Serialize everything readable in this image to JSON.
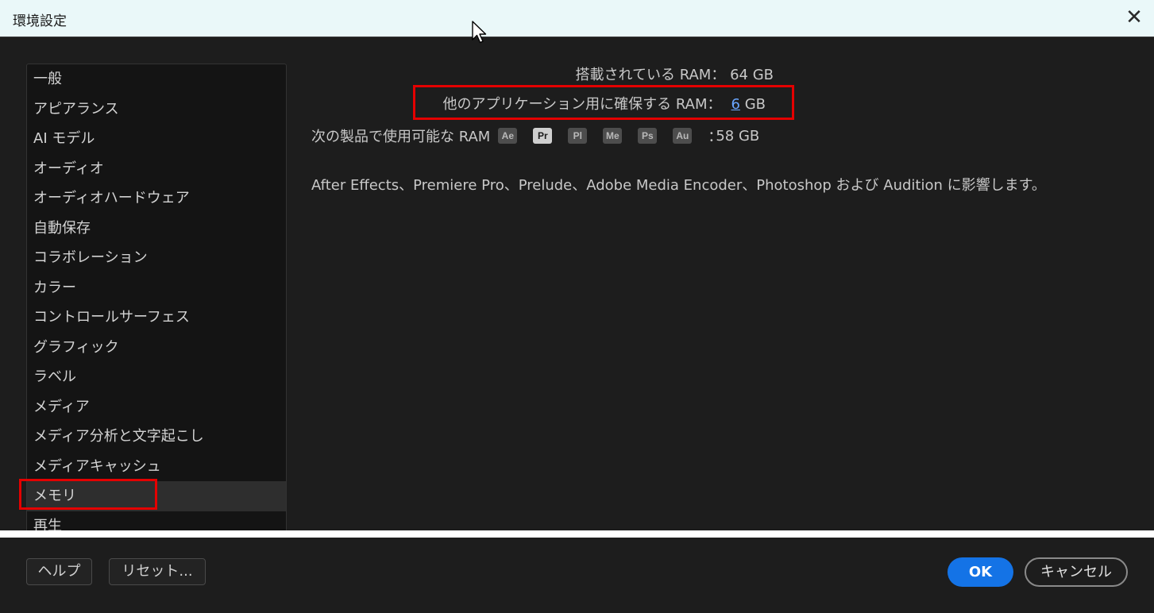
{
  "window": {
    "title": "環境設定",
    "close_glyph": "✕"
  },
  "sidebar": {
    "items": [
      {
        "label": "一般"
      },
      {
        "label": "アピアランス"
      },
      {
        "label": "AI モデル"
      },
      {
        "label": "オーディオ"
      },
      {
        "label": "オーディオハードウェア"
      },
      {
        "label": "自動保存"
      },
      {
        "label": "コラボレーション"
      },
      {
        "label": "カラー"
      },
      {
        "label": "コントロールサーフェス"
      },
      {
        "label": "グラフィック"
      },
      {
        "label": "ラベル"
      },
      {
        "label": "メディア"
      },
      {
        "label": "メディア分析と文字起こし"
      },
      {
        "label": "メディアキャッシュ"
      },
      {
        "label": "メモリ"
      },
      {
        "label": "再生"
      }
    ],
    "selected_label": "メモリ"
  },
  "memory": {
    "installed_label": "搭載されている RAM：",
    "installed_value": "64 GB",
    "reserved_label": "他のアプリケーション用に確保する RAM：",
    "reserved_value": "6",
    "reserved_unit": "GB",
    "available_label": "次の製品で使用可能な RAM",
    "products": [
      {
        "abbr": "Ae",
        "active": false
      },
      {
        "abbr": "Pr",
        "active": true
      },
      {
        "abbr": "Pl",
        "active": false
      },
      {
        "abbr": "Me",
        "active": false
      },
      {
        "abbr": "Ps",
        "active": false
      },
      {
        "abbr": "Au",
        "active": false
      }
    ],
    "available_sep": "：",
    "available_value": "58 GB",
    "note": "After Effects、Premiere Pro、Prelude、Adobe Media Encoder、Photoshop および Audition に影響します。"
  },
  "footer": {
    "help_label": "ヘルプ",
    "reset_label": "リセット...",
    "ok_label": "OK",
    "cancel_label": "キャンセル"
  },
  "colors": {
    "highlight_box": "#e40000",
    "ok_button": "#1473e6",
    "input_value": "#6aa6ff"
  }
}
